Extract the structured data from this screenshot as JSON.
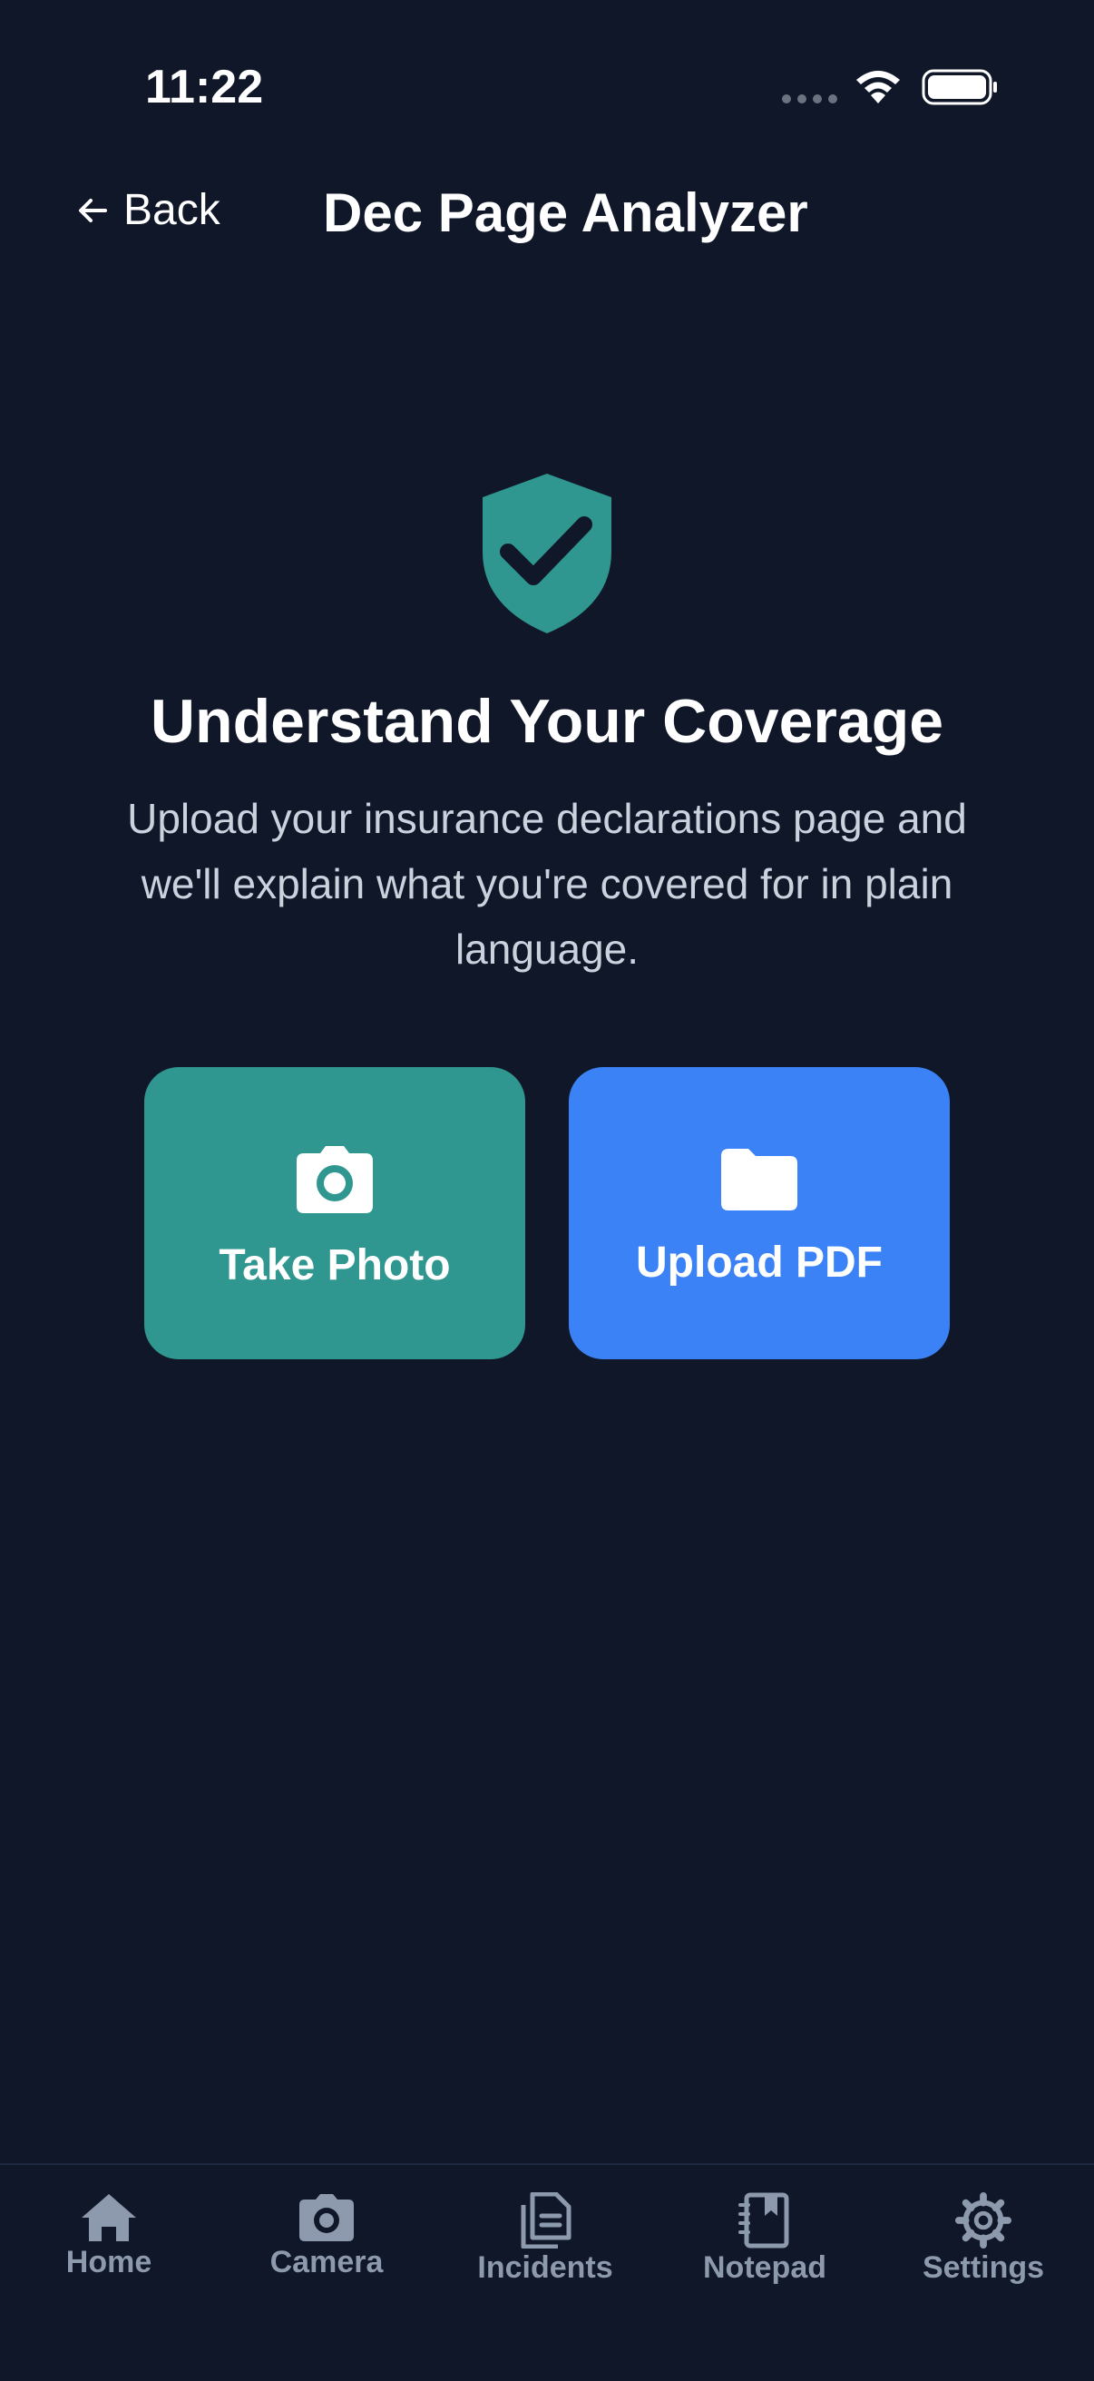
{
  "status_bar": {
    "time": "11:22",
    "icons": [
      "signal-dots-icon",
      "wifi-icon",
      "battery-icon"
    ]
  },
  "nav": {
    "back_label": "Back",
    "back_icon": "arrow-left-icon",
    "title": "Dec Page Analyzer"
  },
  "hero": {
    "icon": "shield-check-icon",
    "heading": "Understand Your Coverage",
    "description": "Upload your insurance declarations page and we'll explain what you're covered for in plain language."
  },
  "actions": [
    {
      "label": "Take Photo",
      "icon": "camera-icon",
      "color": "#2f9690"
    },
    {
      "label": "Upload PDF",
      "icon": "folder-icon",
      "color": "#3b82f6"
    }
  ],
  "tabs": [
    {
      "label": "Home",
      "icon": "home-icon"
    },
    {
      "label": "Camera",
      "icon": "camera-icon"
    },
    {
      "label": "Incidents",
      "icon": "documents-icon"
    },
    {
      "label": "Notepad",
      "icon": "notebook-icon"
    },
    {
      "label": "Settings",
      "icon": "gear-icon"
    }
  ],
  "colors": {
    "background": "#101729",
    "accent_teal": "#2f9690",
    "accent_blue": "#3b82f6",
    "tab_inactive": "#8d99ad",
    "body_text": "#cbd2de"
  }
}
